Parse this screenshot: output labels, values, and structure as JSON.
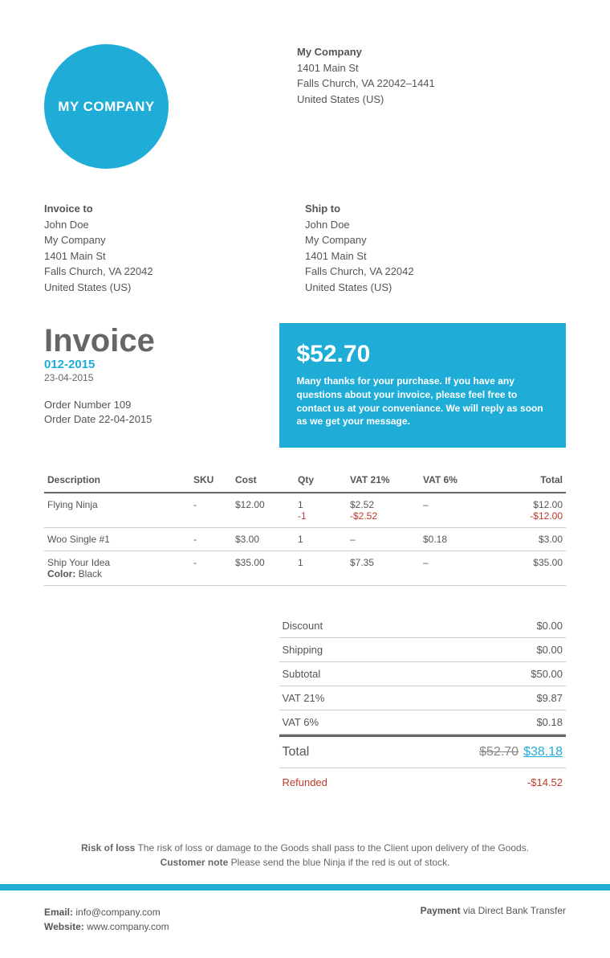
{
  "logo_text": "MY COMPANY",
  "company": {
    "name": "My Company",
    "line1": "1401 Main St",
    "line2": "Falls Church, VA 22042–1441",
    "country": "United States (US)"
  },
  "invoice_to": {
    "label": "Invoice to",
    "name": "John Doe",
    "company": "My Company",
    "line1": "1401 Main St",
    "line2": "Falls Church, VA 22042",
    "country": "United States (US)"
  },
  "ship_to": {
    "label": "Ship to",
    "name": "John Doe",
    "company": "My Company",
    "line1": "1401 Main St",
    "line2": "Falls Church, VA 22042",
    "country": "United States (US)"
  },
  "invoice": {
    "title": "Invoice",
    "number": "012-2015",
    "date": "23-04-2015",
    "order_number": "Order Number 109",
    "order_date": "Order Date 22-04-2015"
  },
  "amount_box": {
    "amount": "$52.70",
    "message": "Many thanks for your purchase. If you have any questions about your invoice, please feel free to contact us at your conveniance. We will reply as soon as we get your message."
  },
  "columns": {
    "description": "Description",
    "sku": "SKU",
    "cost": "Cost",
    "qty": "Qty",
    "vat21": "VAT 21%",
    "vat6": "VAT 6%",
    "total": "Total"
  },
  "items": [
    {
      "description": "Flying Ninja",
      "meta": "",
      "sku": "-",
      "cost": "$12.00",
      "qty": "1",
      "qty_refund": "-1",
      "vat21": "$2.52",
      "vat21_refund": "-$2.52",
      "vat6": "–",
      "total": "$12.00",
      "total_refund": "-$12.00"
    },
    {
      "description": "Woo Single #1",
      "meta": "",
      "sku": "-",
      "cost": "$3.00",
      "qty": "1",
      "qty_refund": "",
      "vat21": "–",
      "vat21_refund": "",
      "vat6": "$0.18",
      "total": "$3.00",
      "total_refund": ""
    },
    {
      "description": "Ship Your Idea",
      "meta_label": "Color:",
      "meta_value": "Black",
      "sku": "-",
      "cost": "$35.00",
      "qty": "1",
      "qty_refund": "",
      "vat21": "$7.35",
      "vat21_refund": "",
      "vat6": "–",
      "total": "$35.00",
      "total_refund": ""
    }
  ],
  "totals": {
    "discount_label": "Discount",
    "discount": "$0.00",
    "shipping_label": "Shipping",
    "shipping": "$0.00",
    "subtotal_label": "Subtotal",
    "subtotal": "$50.00",
    "vat21_label": "VAT 21%",
    "vat21": "$9.87",
    "vat6_label": "VAT 6%",
    "vat6": "$0.18",
    "total_label": "Total",
    "total_old": "$52.70",
    "total_new": "$38.18",
    "refunded_label": "Refunded",
    "refunded": "-$14.52"
  },
  "notes": {
    "risk_label": "Risk of loss",
    "risk_text": "The risk of loss or damage to the Goods shall pass to the Client upon delivery of the Goods.",
    "customer_label": "Customer note",
    "customer_text": "Please send the blue Ninja if the red is out of stock."
  },
  "footer": {
    "email_label": "Email:",
    "email": "info@company.com",
    "website_label": "Website:",
    "website": "www.company.com",
    "payment_label": "Payment",
    "payment": "via Direct Bank Transfer"
  }
}
